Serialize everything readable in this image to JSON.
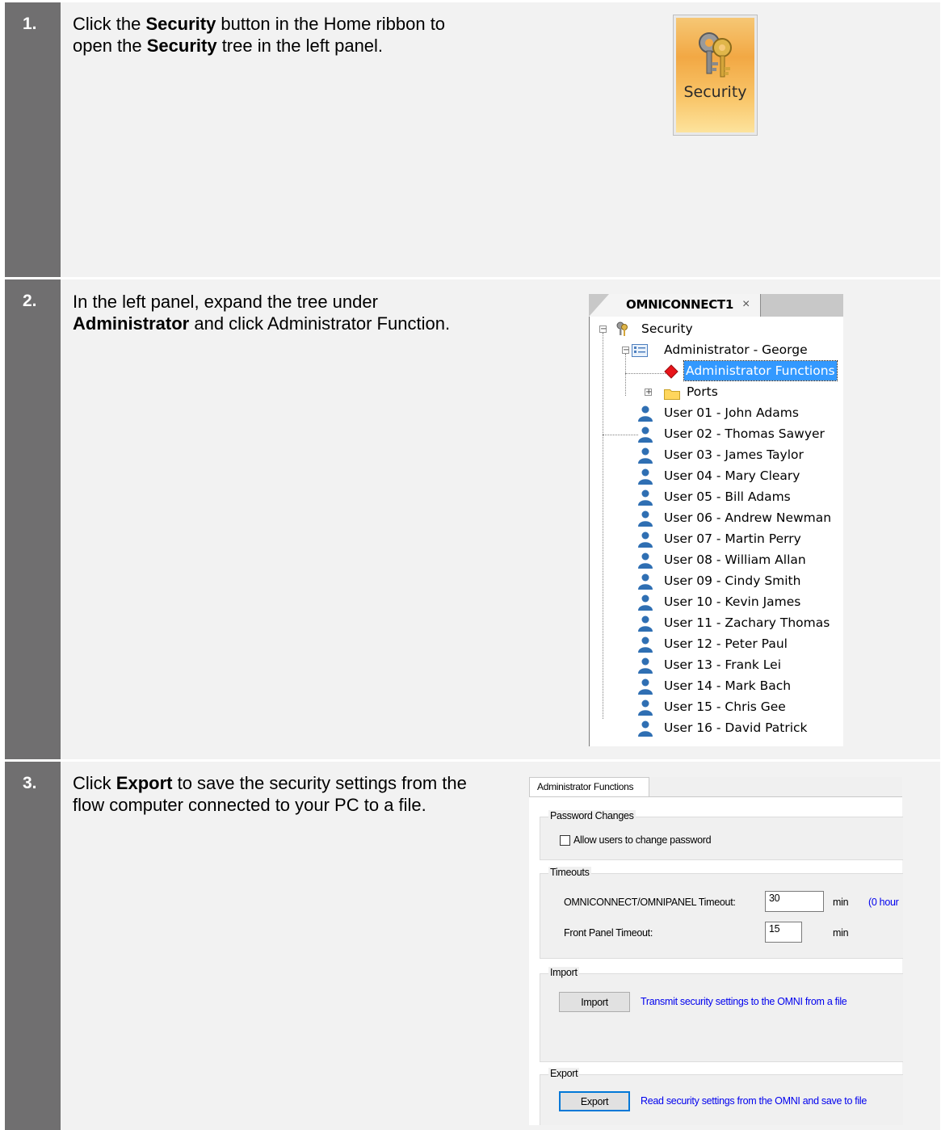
{
  "steps": [
    {
      "number": "1.",
      "text_parts": [
        "Click the ",
        "Security",
        " button in the Home ribbon to open the ",
        "Security",
        " tree in the left panel."
      ]
    },
    {
      "number": "2.",
      "text_parts": [
        "In the left panel, expand the tree under ",
        "Administrator",
        " and click Administrator Function."
      ]
    },
    {
      "number": "3.",
      "text_parts": [
        "Click ",
        "Export",
        " to save the security settings from the flow computer connected to your PC to a file."
      ]
    }
  ],
  "ribbon_button": {
    "label": "Security",
    "icon": "keys-icon"
  },
  "tree": {
    "tab_title": "OMNICONNECT1",
    "tab_close": "×",
    "root": "Security",
    "admin": "Administrator - George",
    "admin_functions": "Administrator Functions",
    "ports": "Ports",
    "users": [
      "User 01 - John Adams",
      "User 02 - Thomas Sawyer",
      "User 03 - James Taylor",
      "User 04 - Mary Cleary",
      "User 05 - Bill Adams",
      "User 06 - Andrew Newman",
      "User 07 - Martin Perry",
      "User 08 - William Allan",
      "User 09 - Cindy Smith",
      "User 10 - Kevin James",
      "User 11 - Zachary Thomas",
      "User 12 - Peter Paul",
      "User 13 - Frank Lei",
      "User 14 - Mark Bach",
      "User 15 - Chris Gee",
      "User 16 - David Patrick"
    ]
  },
  "dialog": {
    "tab": "Administrator Functions",
    "password_group": "Password Changes",
    "allow_change_label": "Allow users to change password",
    "allow_change_checked": false,
    "timeouts_group": "Timeouts",
    "omniconnect_timeout_label": "OMNICONNECT/OMNIPANEL Timeout:",
    "omniconnect_timeout_value": "30",
    "omniconnect_timeout_unit": "min",
    "omniconnect_timeout_note": "(0 hour",
    "front_panel_timeout_label": "Front Panel Timeout:",
    "front_panel_timeout_value": "15",
    "front_panel_timeout_unit": "min",
    "import_group": "Import",
    "import_button": "Import",
    "import_desc": "Transmit security settings to the OMNI from a file",
    "export_group": "Export",
    "export_button": "Export",
    "export_desc": "Read security settings from the OMNI and save to file"
  },
  "colors": {
    "number_column": "#706f70",
    "row_background": "#f2f2f2",
    "selection": "#3399ff",
    "link": "#0000ee",
    "user_icon": "#2f6fb3"
  }
}
